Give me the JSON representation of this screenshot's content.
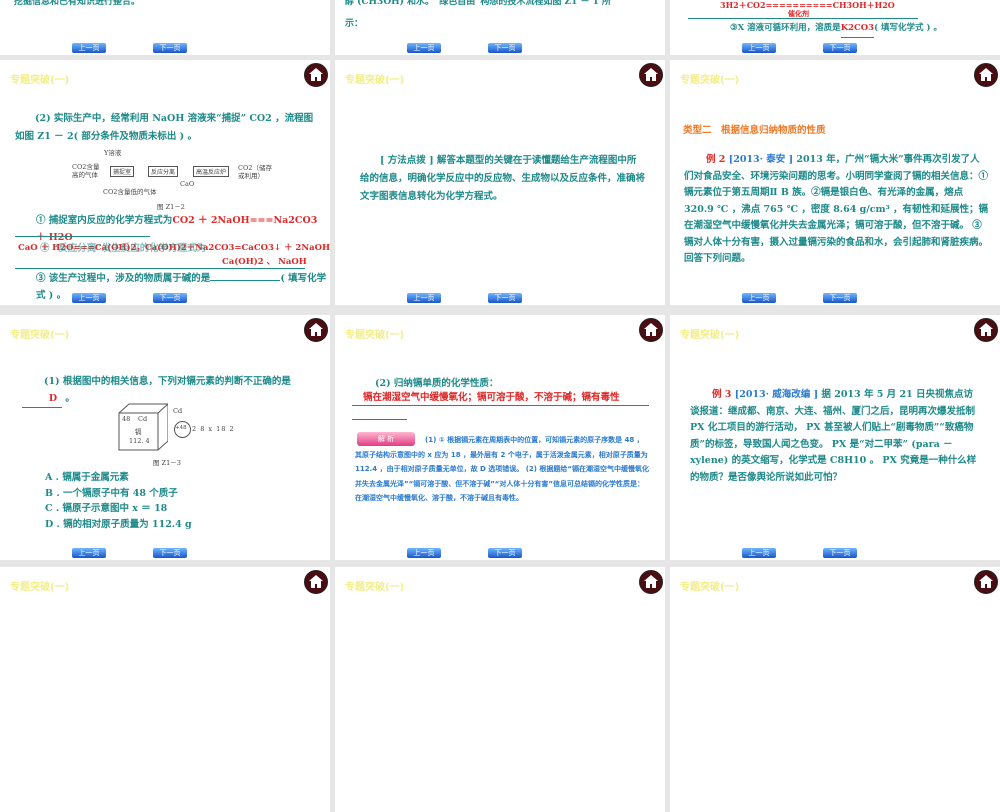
{
  "header": "专题突破(一)",
  "nav": {
    "prev": "上一页",
    "next": "下一页"
  },
  "top_row": {
    "s1": "挖掘信息和已有知识进行整合。",
    "s2_line1": "醇 (CH3OH) 和水。“绿色自由”构想的技术流程如图 Z1 － 1 所",
    "s2_line2": "示：",
    "s3_eq": "3H2＋CO2==========CH3OH＋H2O",
    "s3_cat": "催化剂",
    "s3_q": "③X 溶液可循环利用，溶质是",
    "s3_ans": "K2CO3",
    "s3_tail": "( 填写化学式 ) 。"
  },
  "slide_a": {
    "intro": "(2) 实际生产中，经常利用 NaOH 溶液来“捕捉” CO2 ，流程图如图 Z1 － 2( 部分条件及物质未标出 ) 。",
    "fig": {
      "y": "Y溶液",
      "in": "CO2含量高的气体",
      "b1": "捕捉室",
      "b2": "反应分离",
      "b3": "高温反应炉",
      "out": "CO2（储存或利用）",
      "cao": "CaO",
      "low": "CO2含量低的气体",
      "caption": "图 Z1－2"
    },
    "q1": "① 捕捉室内反应的化学方程式为",
    "a1": "CO2 ＋ 2NaOH===Na2CO3 ＋ H2O",
    "q2": "② “反应分离”发生反应的化学方程式为",
    "a2": "CaO ＋ H2O===Ca(OH)2，Ca(OH)2＋Na2CO3=CaCO3↓ ＋ 2NaOH",
    "q3": "③ 该生产过程中，涉及的物质属于碱的是",
    "a3": "Ca(OH)2 、 NaOH",
    "q3tail": "( 填写化学式 ) 。"
  },
  "slide_b": {
    "text": "[ 方法点拨 ] 解答本题型的关键在于读懂题给生产流程图中所给的信息，明确化学反应中的反应物、生成物以及反应条件，准确将文字图表信息转化为化学方程式。"
  },
  "slide_c": {
    "title": "类型二　根据信息归纳物质的性质",
    "label": "例 2",
    "source": "[2013· 泰安 ]",
    "text": "2013 年，广州“镉大米”事件再次引发了人们对食品安全、环境污染问题的思考。小明同学查阅了镉的相关信息：①镉元素位于第五周期Ⅱ B 族。②镉是银白色、有光泽的金属，熔点 320.9 ℃ ，沸点 765 ℃ ，密度 8.64 g/cm³ ，有韧性和延展性；镉在潮湿空气中缓慢氧化并失去金属光泽；镉可溶于酸，但不溶于碱。 ③镉对人体十分有害，摄入过量镉污染的食品和水，会引起肺和肾脏疾病。回答下列问题。"
  },
  "slide_d": {
    "q": "(1) 根据图中的相关信息，下列对镉元素的判断不正确的是",
    "ans": "D",
    "fig": {
      "num": "48",
      "sym": "Cd",
      "name": "镉",
      "mass": "112. 4",
      "atom": "+48",
      "shells": "2 8 x 18 2",
      "caption": "图 Z1－3"
    },
    "options": [
      "A . 镉属于金属元素",
      "B . 一个镉原子中有 48 个质子",
      "C . 镉原子示意图中 x ＝ 18",
      "D . 镉的相对原子质量为 112.4 g"
    ]
  },
  "slide_e": {
    "q": "(2) 归纳镉单质的化学性质：",
    "ans": "镉在潮湿空气中缓慢氧化；镉可溶于酸，不溶于碱；镉有毒性",
    "tag": "解 析",
    "analysis": "(1) ① 根据镉元素在周期表中的位置，可知镉元素的原子序数是 48 ，其原子结构示意图中的 x 应为 18 ，最外层有 2 个电子，属于活泼金属元素，相对原子质量为 112.4 ，由于相对原子质量无单位，故 D 选项错误。 (2) 根据题给“镉在潮湿空气中缓慢氧化并失去金属光泽”“镉可溶于酸、但不溶于碱”“对人体十分有害”信息可总结镉的化学性质是：在潮湿空气中缓慢氧化、溶于酸，不溶于碱且有毒性。"
  },
  "slide_f": {
    "label": "例 3",
    "source": "[2013· 威海改编 ]",
    "text": "据 2013 年 5 月 21 日央视焦点访谈报道：继成都、南京、大连、福州、厦门之后，昆明再次爆发抵制 PX 化工项目的游行活动， PX 甚至被人们贴上“剧毒物质”“致癌物质”的标签，导致国人闻之色变。 PX 是“对二甲苯” (para － xylene) 的英文缩写，化学式是 C8H10 。 PX 究竟是一种什么样的物质？是否像舆论所说如此可怕？"
  }
}
